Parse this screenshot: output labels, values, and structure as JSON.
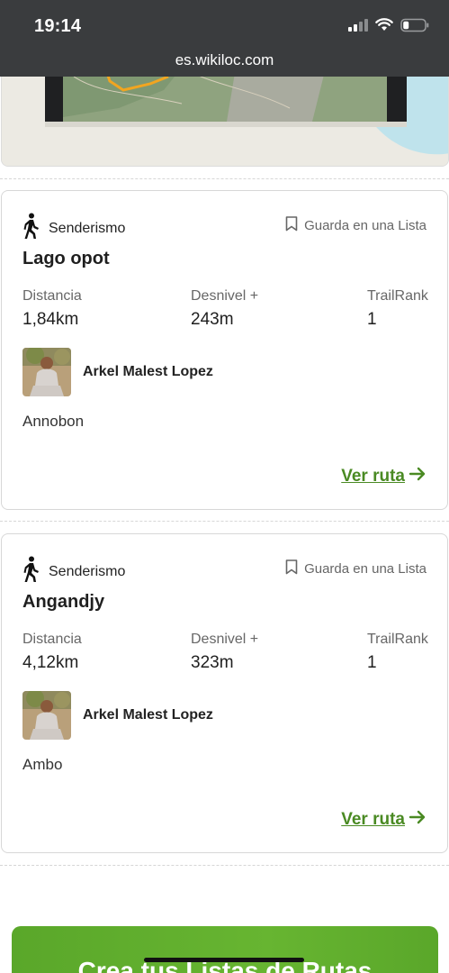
{
  "status_bar": {
    "time": "19:14",
    "url": "es.wikiloc.com"
  },
  "routes": [
    {
      "activity": "Senderismo",
      "save_label": "Guarda en una Lista",
      "title": "Lago opot",
      "stats": [
        {
          "label": "Distancia",
          "value": "1,84km"
        },
        {
          "label": "Desnivel +",
          "value": "243m"
        },
        {
          "label": "TrailRank",
          "value": "1"
        }
      ],
      "author": "Arkel Malest Lopez",
      "location": "Annobon",
      "view_label": "Ver ruta"
    },
    {
      "activity": "Senderismo",
      "save_label": "Guarda en una Lista",
      "title": "Angandjy",
      "stats": [
        {
          "label": "Distancia",
          "value": "4,12km"
        },
        {
          "label": "Desnivel +",
          "value": "323m"
        },
        {
          "label": "TrailRank",
          "value": "1"
        }
      ],
      "author": "Arkel Malest Lopez",
      "location": "Ambo",
      "view_label": "Ver ruta"
    }
  ],
  "promo": {
    "text": "Crea tus Listas de Rutas"
  },
  "colors": {
    "accent": "#4a8a23",
    "status_bar": "#3a3c3e",
    "promo": "#63b02f"
  },
  "icons": {
    "activity": "hiker-icon",
    "save": "bookmark-icon",
    "view": "arrow-right-icon"
  }
}
